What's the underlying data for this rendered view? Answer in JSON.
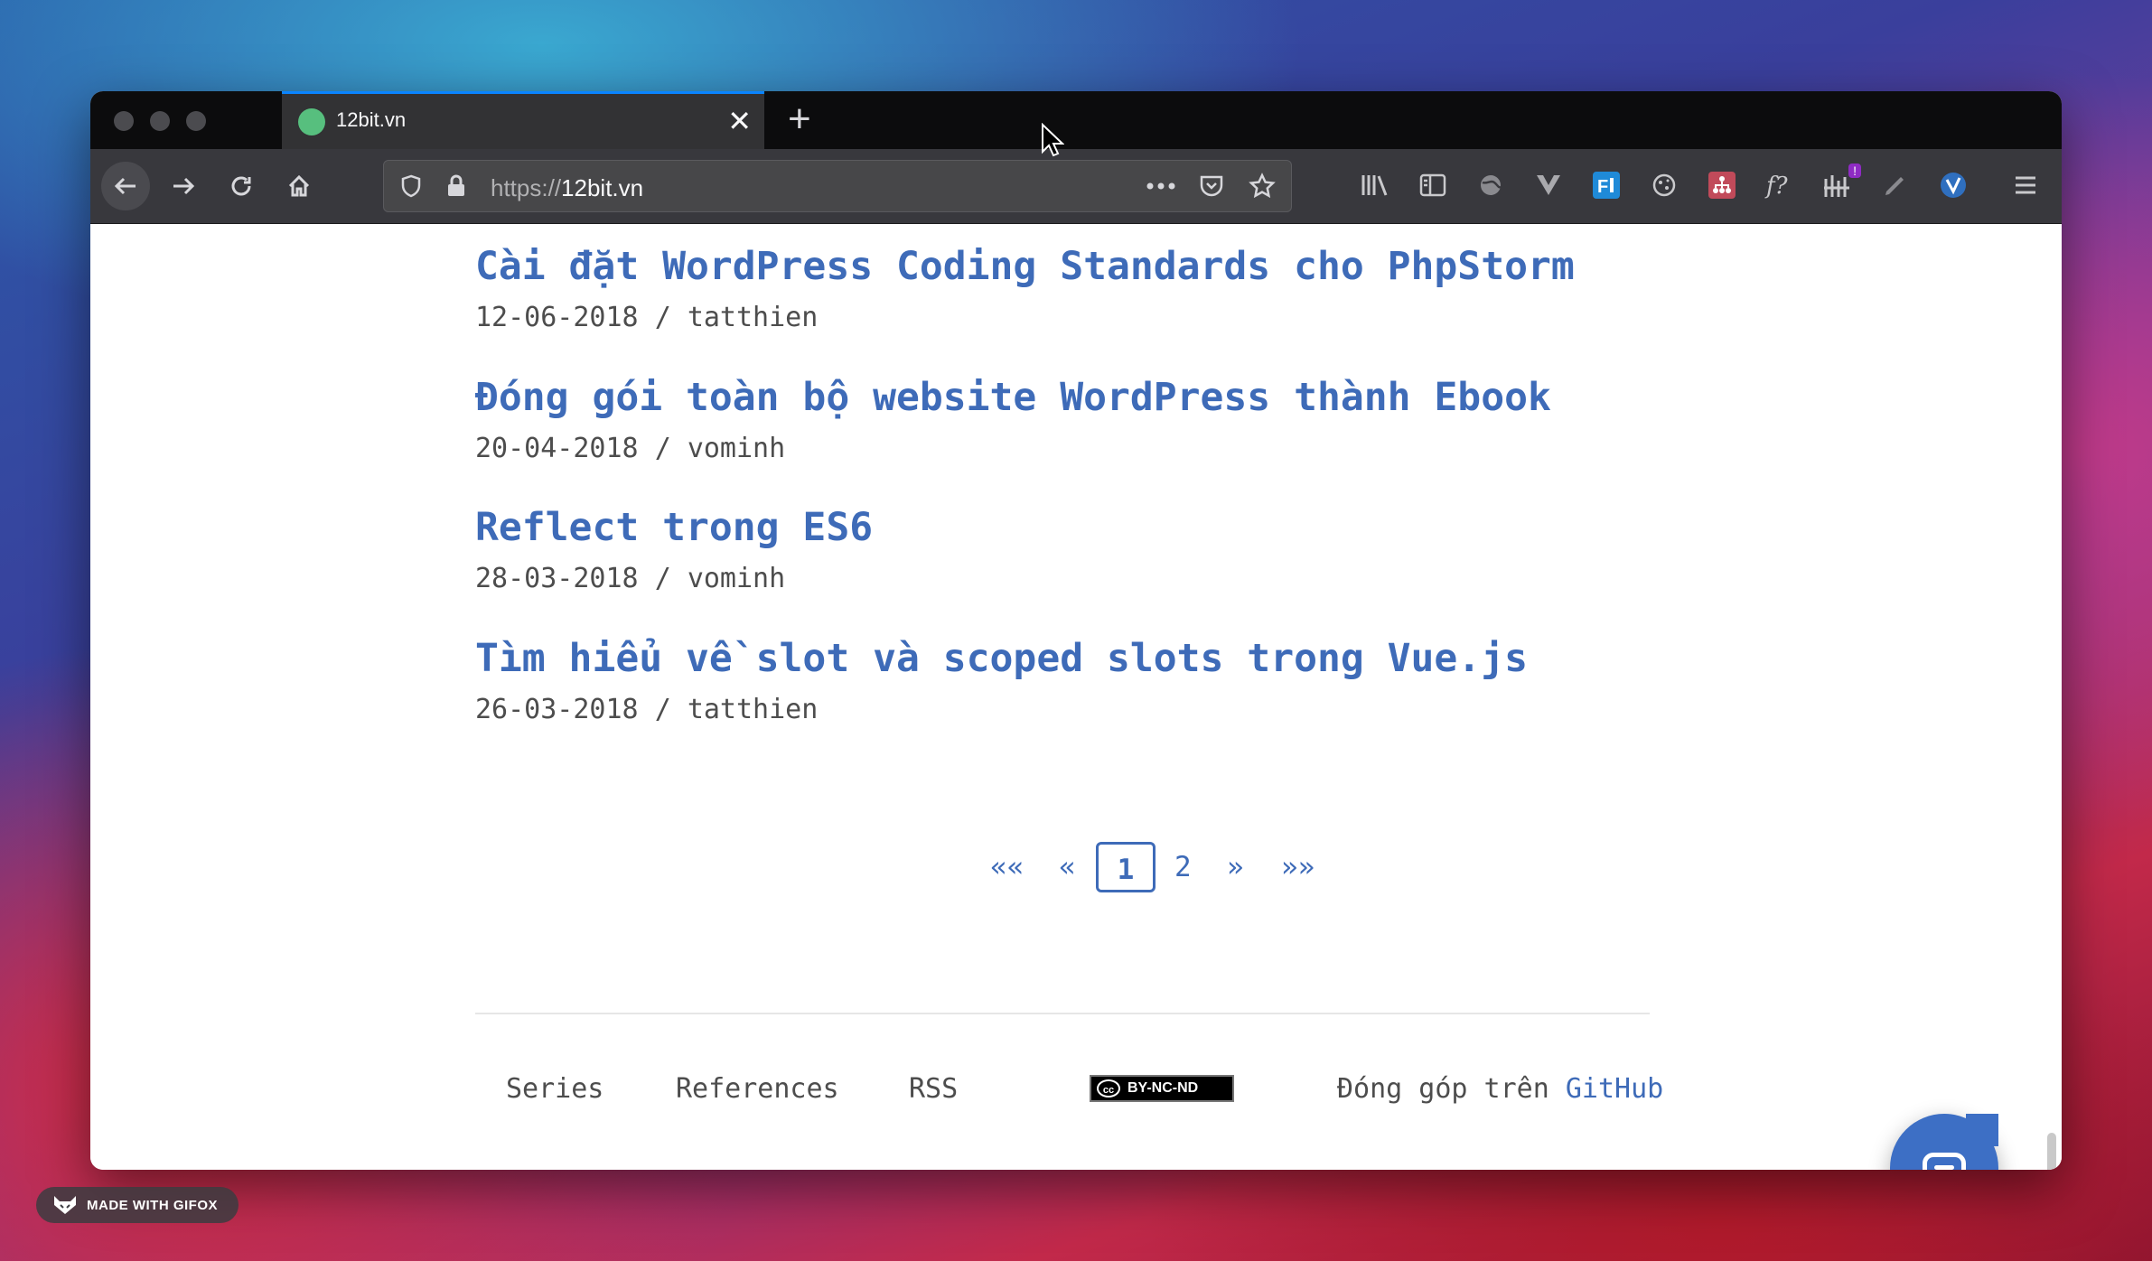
{
  "browser": {
    "tab_title": "12bit.vn",
    "tab_close": "✕",
    "new_tab": "+",
    "url_scheme": "https://",
    "url_host": "12bit.vn",
    "toolbar_icons": [
      "back-icon",
      "forward-icon",
      "reload-icon",
      "home-icon"
    ],
    "url_icons": [
      "shield-icon",
      "lock-icon",
      "more-icon",
      "pocket-icon",
      "star-icon"
    ],
    "extension_icons": [
      "library-icon",
      "sidebar-icon",
      "globe-icon",
      "vue-devtools-icon",
      "fi-icon",
      "cookie-icon",
      "sitemap-icon",
      "font-icon",
      "wappalyzer-icon",
      "pen-icon",
      "vimium-icon",
      "hamburger-menu-icon"
    ],
    "extension_badge": "!"
  },
  "posts": [
    {
      "title": "Cài đặt WordPress Coding Standards cho PhpStorm",
      "date": "12-06-2018",
      "sep": "/",
      "author": "tatthien"
    },
    {
      "title": "Đóng gói toàn bộ website WordPress thành Ebook",
      "date": "20-04-2018",
      "sep": "/",
      "author": "vominh"
    },
    {
      "title": "Reflect trong ES6",
      "date": "28-03-2018",
      "sep": "/",
      "author": "vominh"
    },
    {
      "title": "Tìm hiểu về slot và scoped slots trong Vue.js",
      "date": "26-03-2018",
      "sep": "/",
      "author": "tatthien"
    }
  ],
  "pagination": {
    "first": "««",
    "prev": "«",
    "current": "1",
    "page2": "2",
    "next": "»",
    "last": "»»"
  },
  "footer": {
    "series": "Series",
    "references": "References",
    "rss": "RSS",
    "license_text": "BY-NC-ND",
    "contribute": "Đóng góp trên",
    "github": "GitHub"
  },
  "watermark": "MADE WITH GIFOX",
  "colors": {
    "link": "#3e6bb8",
    "meta": "#4d4d4d",
    "chat": "#3d6fc5"
  }
}
